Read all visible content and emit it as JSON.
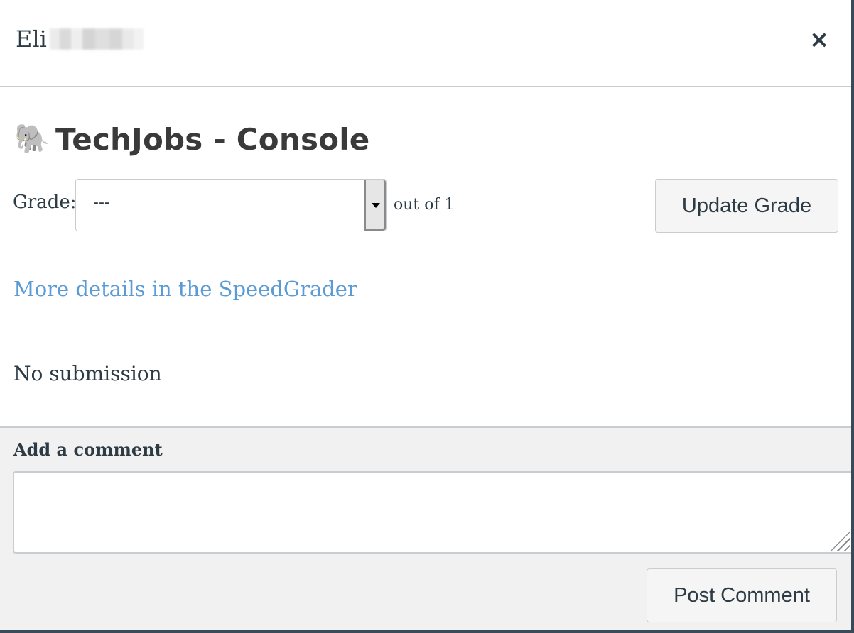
{
  "header": {
    "student_name": "Eli",
    "close_symbol": "×",
    "close_icon": "close-icon"
  },
  "assignment": {
    "icon": "elephant-icon",
    "icon_glyph": "🐘",
    "title": "TechJobs - Console"
  },
  "grade": {
    "label": "Grade:",
    "selected_value": "---",
    "out_of": "out of 1",
    "update_button": "Update Grade"
  },
  "links": {
    "speedgrader": "More details in the SpeedGrader"
  },
  "submission": {
    "status": "No submission"
  },
  "comment": {
    "label": "Add a comment",
    "value": "",
    "post_button": "Post Comment"
  },
  "colors": {
    "link": "#5b9bd5",
    "text": "#2d3b45",
    "comment_background": "#f1f1f1",
    "border": "#c7cdd1"
  }
}
